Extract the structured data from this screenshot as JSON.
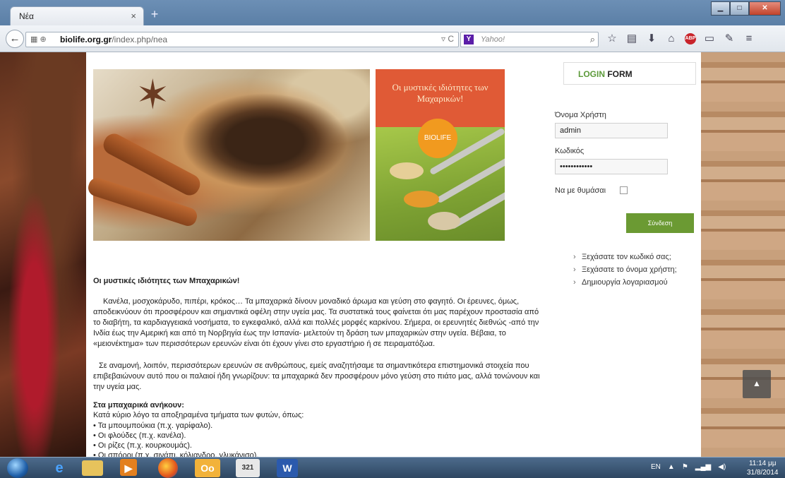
{
  "browser": {
    "tab_title": "Νέα",
    "tab_close": "×",
    "new_tab": "+",
    "url_host": "biolife.org.gr",
    "url_path": "/index.php/nea",
    "search_placeholder": "Yahoo!",
    "search_engine_letter": "Y",
    "abp_label": "ABP"
  },
  "page": {
    "banner_side_title": "Οι μυστικές ιδιότητες των Μαχαρικών!",
    "promo_badge": "BIOLIFE",
    "article": {
      "title": "Οι μυστικές ιδιότητες των Μπαχαρικών!",
      "p1": "Κανέλα, μοσχοκάρυδο, πιπέρι, κρόκος… Τα μπαχαρικά δίνουν μοναδικό άρωμα και γεύση στο φαγητό. Οι έρευνες, όμως, αποδεικνύουν ότι προσφέρουν και σημαντικά οφέλη στην υγεία μας. Τα συστατικά τους φαίνεται ότι μας παρέχουν προστασία από το διαβήτη, τα καρδιαγγειακά νοσήματα, το εγκεφαλικό, αλλά και πολλές μορφές καρκίνου. Σήμερα, οι ερευνητές διεθνώς -από την Ινδία έως την Αμερική και από τη Νορβηγία έως την Ισπανία- μελετούν τη δράση των μπαχαρικών στην υγεία. Βέβαια, το «μειονέκτημα» των περισσότερων ερευνών είναι ότι έχουν γίνει στο εργαστήριο ή σε πειραματόζωα.",
      "p2": "Σε αναμονή, λοιπόν, περισσότερων ερευνών σε ανθρώπους, εμείς αναζητήσαμε τα σημαντικότερα επιστημονικά στοιχεία που επιβεβαιώνουν αυτό που οι παλαιοί ήδη γνωρίζουν: τα μπαχαρικά δεν προσφέρουν μόνο γεύση στο πιάτο μας, αλλά τονώνουν και την υγεία μας.",
      "subheading": "Στα μπαχαρικά ανήκουν:",
      "intro": "Κατά κύριο λόγο τα αποξηραμένα τμήματα των φυτών, όπως:",
      "bullets": [
        "• Τα μπουμπούκια (π.χ. γαρίφαλο).",
        "• Οι φλούδες (π.χ. κανέλα).",
        "• Οι ρίζες (π.χ. κουρκουμάς).",
        "• Οι σπόροι (π.χ. σινάπι, κόλιανδρο, γλυκάνισο)."
      ]
    },
    "login": {
      "heading_green": "LOGIN",
      "heading_dark": " FORM",
      "username_label": "Όνομα Χρήστη",
      "username_value": "admin",
      "password_label": "Κωδικός",
      "password_value": "••••••••••••",
      "remember_label": "Να με θυμάσαι",
      "submit_label": "Σύνδεση",
      "links": [
        "Ξεχάσατε τον κωδικό σας;",
        "Ξεχάσατε το όνομα χρήστη;",
        "Δημιουργία λογαριασμού"
      ]
    }
  },
  "taskbar": {
    "lang": "EN",
    "time": "11:14 μμ",
    "date": "31/8/2014",
    "calendar_label": "321",
    "word_label": "W"
  },
  "colors": {
    "accent_green": "#6b9a33",
    "promo_orange": "#e05a36"
  }
}
